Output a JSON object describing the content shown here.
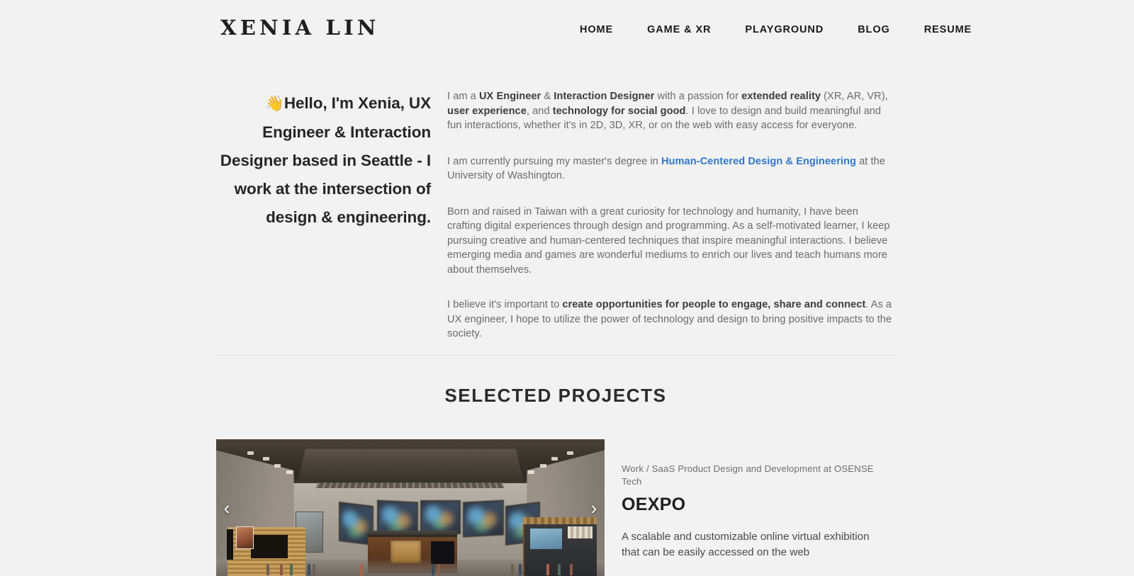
{
  "site": {
    "background_color": "#f2f2f2",
    "brand": "XENIA LIN"
  },
  "nav": {
    "items": [
      {
        "label": "HOME"
      },
      {
        "label": "GAME & XR"
      },
      {
        "label": "PLAYGROUND"
      },
      {
        "label": "BLOG"
      },
      {
        "label": "RESUME"
      }
    ]
  },
  "intro": {
    "headline_emoji": "👋",
    "headline": "Hello, I'm Xenia, UX Engineer & Interaction Designer based in Seattle - I work at the intersection of design & engineering.",
    "paragraph1": {
      "part1": "I am a ",
      "bold1": "UX Engineer",
      "part2": " & ",
      "bold2": "Interaction Designer",
      "part3": " with a passion for ",
      "bold3": "extended reality",
      "part4": " (XR, AR, VR), ",
      "bold4": "user experience",
      "part5": ", and ",
      "bold5": "technology for social good",
      "part6": ". I love to design and build meaningful and fun interactions, whether it's in 2D, 3D, XR, or on the web with easy access for everyone."
    },
    "paragraph2": {
      "part1": "I am currently pursuing my master's degree in ",
      "link": "Human-Centered Design & Engineering",
      "link_color": "#3179c9",
      "part2": " at the University of Washington."
    },
    "paragraph3": "Born and raised in Taiwan with a great curiosity for technology and humanity, I have been crafting digital experiences through design and programming. As a self-motivated learner, I keep pursuing creative and human-centered techniques that inspire meaningful interactions. I believe emerging media and games are wonderful mediums to enrich our lives and teach humans more about themselves.",
    "paragraph4": {
      "part1": "I believe it's important to ",
      "bold1": "create opportunities for people to engage, share and connect",
      "part2": ". As a UX engineer, I hope to utilize the power of technology and design to bring positive impacts to the society."
    }
  },
  "projects": {
    "section_title": "SELECTED PROJECTS",
    "carousel": {
      "prev_label": "‹",
      "next_label": "›",
      "image_alt": "3D rendered virtual exhibition hall interior with banners and booths"
    },
    "featured": {
      "eyebrow": "Work / SaaS Product Design and Development at OSENSE Tech",
      "title": "OEXPO",
      "description": "A scalable and customizable online virtual exhibition that can be easily accessed on the web"
    }
  }
}
